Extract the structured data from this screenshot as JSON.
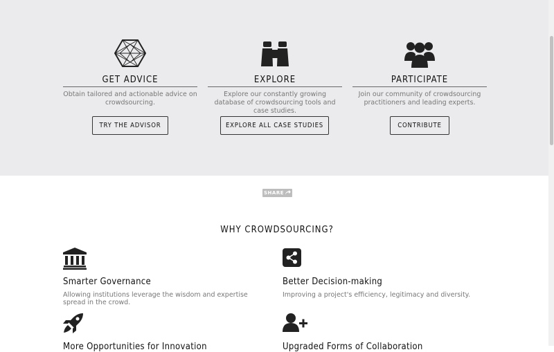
{
  "hero": {
    "columns": [
      {
        "title": "GET ADVICE",
        "description": "Obtain tailored and actionable advice on crowdsourcing.",
        "button": "TRY THE ADVISOR",
        "icon": "hexagon-network-icon"
      },
      {
        "title": "EXPLORE",
        "description": "Explore our constantly growing database of crowdsourcing tools and case studies.",
        "button": "EXPLORE ALL CASE STUDIES",
        "icon": "binoculars-icon"
      },
      {
        "title": "PARTICIPATE",
        "description": "Join our community of crowdsourcing practitioners and leading experts.",
        "button": "CONTRIBUTE",
        "icon": "users-group-icon"
      }
    ]
  },
  "share": {
    "label": "SHARE",
    "icon": "share-arrow-icon"
  },
  "why": {
    "title": "WHY CROWDSOURCING?",
    "features": [
      {
        "title": "Smarter Governance",
        "description": "Allowing institutions leverage the wisdom and expertise spread in the crowd.",
        "icon": "institution-icon"
      },
      {
        "title": "Better Decision-making",
        "description": "Improving a project's efficiency, legitimacy and diversity.",
        "icon": "share-nodes-icon"
      },
      {
        "title": "More Opportunities for Innovation",
        "description": "",
        "icon": "rocket-icon"
      },
      {
        "title": "Upgraded Forms of Collaboration",
        "description": "",
        "icon": "user-plus-icon"
      }
    ]
  },
  "colors": {
    "hero_background": "#ebebed",
    "text_dark": "#111111",
    "text_muted": "#777777",
    "share_background": "#bdbdbd"
  }
}
